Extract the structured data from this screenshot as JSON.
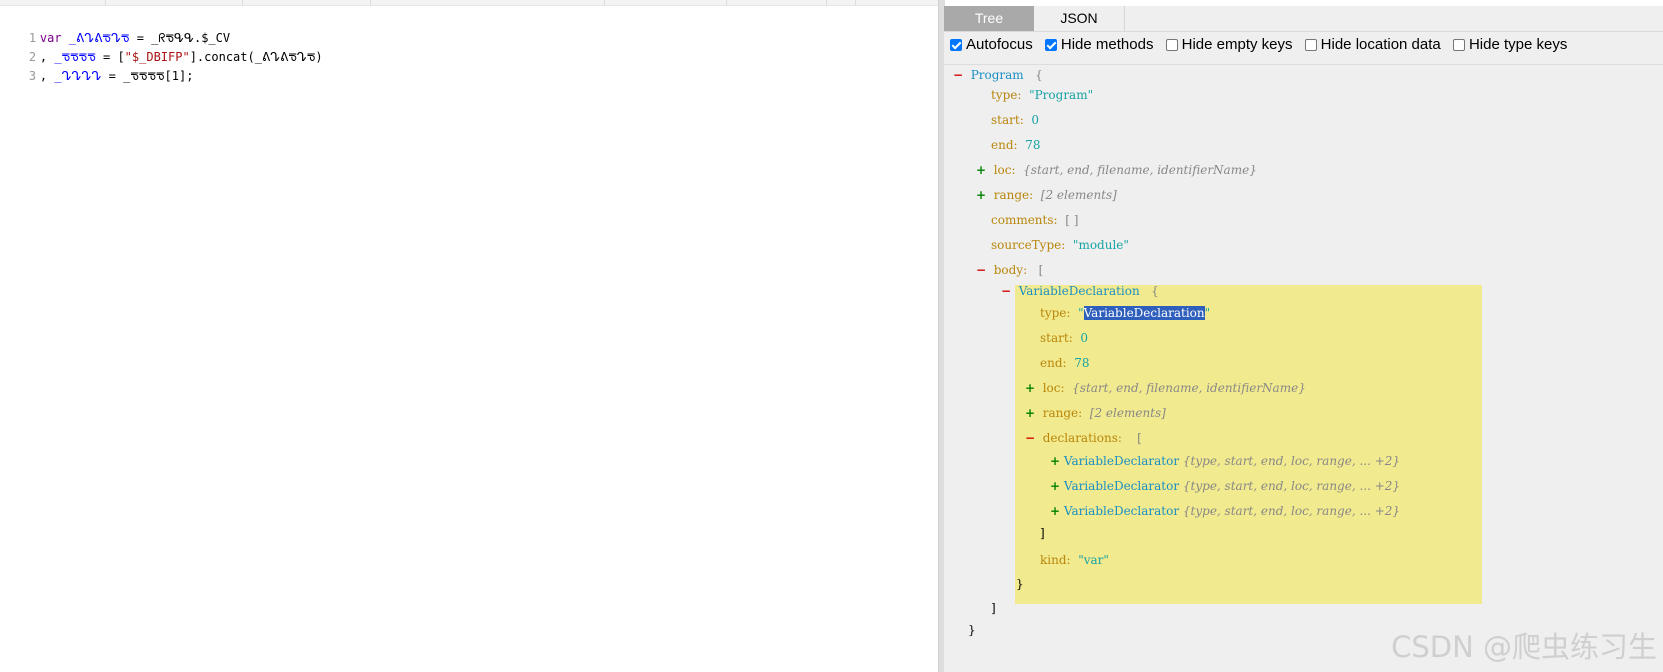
{
  "editor": {
    "lines": [
      {
        "num": "1",
        "p1": "var ",
        "p2": "_ᕕᖊᕕᖛᖊᖛ",
        "p3": " = _ᖇᖛᕴᕴ.$_CV",
        "p4": "",
        "p5": ""
      },
      {
        "num": "2",
        "p1": ", ",
        "p2": "_ᖛᖛᖛᖛ",
        "p3": " = [",
        "p4": "\"$_DBIFP\"",
        "p5": "].concat(_ᕕᖊᕕᖛᖊᖛ)"
      },
      {
        "num": "3",
        "p1": ", ",
        "p2": "_ᖊᖊᖊᖊ",
        "p3": " = _ᖛᖛᖛᖛ[1];",
        "p4": "",
        "p5": ""
      }
    ]
  },
  "panel": {
    "tabs": [
      "Tree",
      "JSON"
    ],
    "options": [
      {
        "label": "Autofocus",
        "checked": true
      },
      {
        "label": "Hide methods",
        "checked": true
      },
      {
        "label": "Hide empty keys",
        "checked": false
      },
      {
        "label": "Hide location data",
        "checked": false
      },
      {
        "label": "Hide type keys",
        "checked": false
      }
    ]
  },
  "tree": {
    "program": "Program",
    "open_brace": "{",
    "close_brace": "}",
    "type_key": "type:",
    "type_val": "\"Program\"",
    "start_key": "start:",
    "start_val": "0",
    "end_key": "end:",
    "end_val": "78",
    "loc_key": "loc:",
    "loc_meta": "{start, end, filename, identifierName}",
    "range_key": "range:",
    "range_meta": "[2 elements]",
    "comments_key": "comments:",
    "comments_val": "[ ]",
    "sourceType_key": "sourceType:",
    "sourceType_val": "\"module\"",
    "body_key": "body:",
    "open_bracket": "[",
    "close_bracket": "]",
    "vd_name": "VariableDeclaration",
    "vd_type_val": "VariableDeclaration",
    "vd_start_val": "0",
    "vd_end_val": "78",
    "declarations_key": "declarations:",
    "declarator": "VariableDeclarator",
    "declarator_meta": "{type, start, end, loc, range, ... +2}",
    "kind_key": "kind:",
    "kind_val": "\"var\"",
    "minus": "−",
    "plus": "+"
  },
  "watermark": "CSDN @爬虫练习生"
}
